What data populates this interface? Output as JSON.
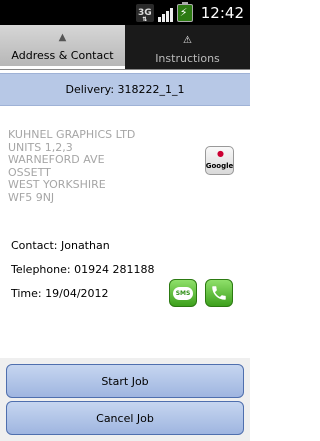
{
  "status_bar": {
    "network": "3G",
    "time": "12:42"
  },
  "tabs": [
    {
      "label": "Address & Contact",
      "icon": "person-icon",
      "active": true
    },
    {
      "label": "Instructions",
      "icon": "warning-icon",
      "active": false
    }
  ],
  "delivery": {
    "title": "Delivery: 318222_1_1"
  },
  "address": {
    "lines": [
      "KUHNEL GRAPHICS LTD",
      "UNITS 1,2,3",
      "WARNEFORD AVE",
      "OSSETT",
      "WEST YORKSHIRE",
      "WF5 9NJ"
    ],
    "map_button_label": "Google"
  },
  "contact": {
    "contact": "Contact: Jonathan",
    "telephone": "Telephone: 01924 281188",
    "time": "Time: 19/04/2012",
    "sms_label": "SMS"
  },
  "actions": {
    "start_label": "Start Job",
    "cancel_label": "Cancel Job"
  }
}
